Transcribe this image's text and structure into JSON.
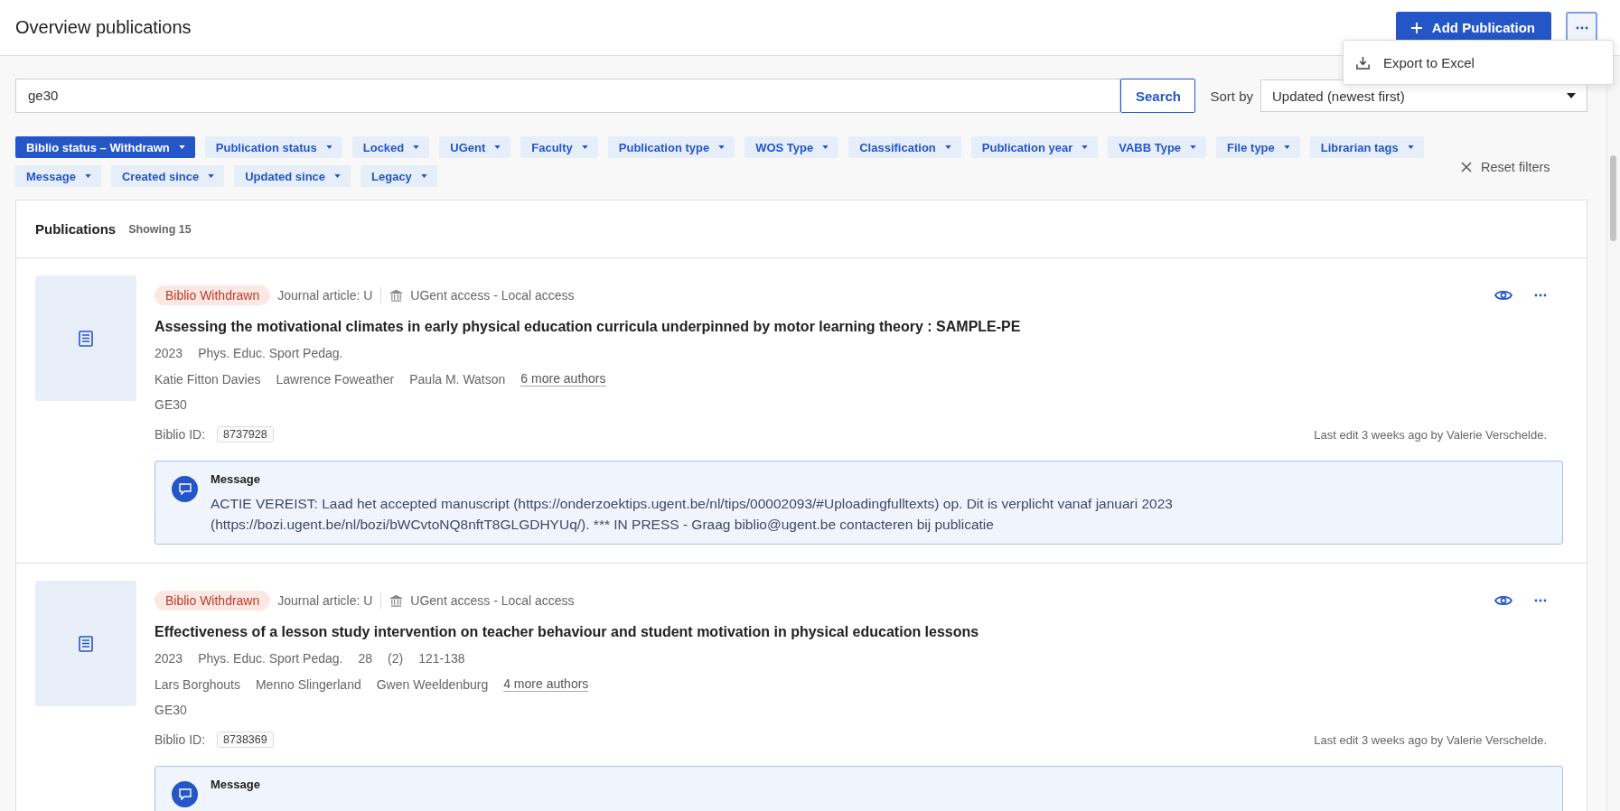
{
  "header": {
    "title": "Overview publications",
    "add_button": "Add Publication"
  },
  "menu": {
    "items": [
      {
        "label": "Export to Excel"
      }
    ]
  },
  "search": {
    "value": "ge30",
    "button": "Search",
    "sort_label": "Sort by",
    "sort_value": "Updated (newest first)"
  },
  "filters": {
    "items": [
      {
        "label": "Biblio status – Withdrawn",
        "active": true
      },
      {
        "label": "Publication status",
        "active": false
      },
      {
        "label": "Locked",
        "active": false
      },
      {
        "label": "UGent",
        "active": false
      },
      {
        "label": "Faculty",
        "active": false
      },
      {
        "label": "Publication type",
        "active": false
      },
      {
        "label": "WOS Type",
        "active": false
      },
      {
        "label": "Classification",
        "active": false
      },
      {
        "label": "Publication year",
        "active": false
      },
      {
        "label": "VABB Type",
        "active": false
      },
      {
        "label": "File type",
        "active": false
      },
      {
        "label": "Librarian tags",
        "active": false
      },
      {
        "label": "Message",
        "active": false
      },
      {
        "label": "Created since",
        "active": false
      },
      {
        "label": "Updated since",
        "active": false
      },
      {
        "label": "Legacy",
        "active": false
      }
    ],
    "reset": "Reset filters"
  },
  "list": {
    "title": "Publications",
    "count": "Showing 15",
    "items": [
      {
        "status": "Biblio Withdrawn",
        "type": "Journal article: U",
        "access": "UGent access - Local access",
        "title": "Assessing the motivational climates in early physical education curricula underpinned by motor learning theory : SAMPLE-PE",
        "meta": [
          "2023",
          "Phys. Educ. Sport Pedag."
        ],
        "authors": [
          "Katie Fitton Davies",
          "Lawrence Foweather",
          "Paula M. Watson"
        ],
        "more_authors": "6 more authors",
        "tag": "GE30",
        "id_label": "Biblio ID:",
        "id": "8737928",
        "last_edit": "Last edit 3 weeks ago by Valerie Verschelde.",
        "message": {
          "title": "Message",
          "text": "ACTIE VEREIST: Laad het accepted manuscript (https://onderzoektips.ugent.be/nl/tips/00002093/#Uploadingfulltexts) op. Dit is verplicht vanaf januari 2023 (https://bozi.ugent.be/nl/bozi/bWCvtoNQ8nftT8GLGDHYUq/). *** IN PRESS - Graag biblio@ugent.be contacteren bij publicatie"
        }
      },
      {
        "status": "Biblio Withdrawn",
        "type": "Journal article: U",
        "access": "UGent access - Local access",
        "title": "Effectiveness of a lesson study intervention on teacher behaviour and student motivation in physical education lessons",
        "meta": [
          "2023",
          "Phys. Educ. Sport Pedag.",
          "28",
          "(2)",
          "121-138"
        ],
        "authors": [
          "Lars Borghouts",
          "Menno Slingerland",
          "Gwen Weeldenburg"
        ],
        "more_authors": "4 more authors",
        "tag": "GE30",
        "id_label": "Biblio ID:",
        "id": "8738369",
        "last_edit": "Last edit 3 weeks ago by Valerie Verschelde.",
        "message": {
          "title": "Message"
        }
      }
    ]
  }
}
